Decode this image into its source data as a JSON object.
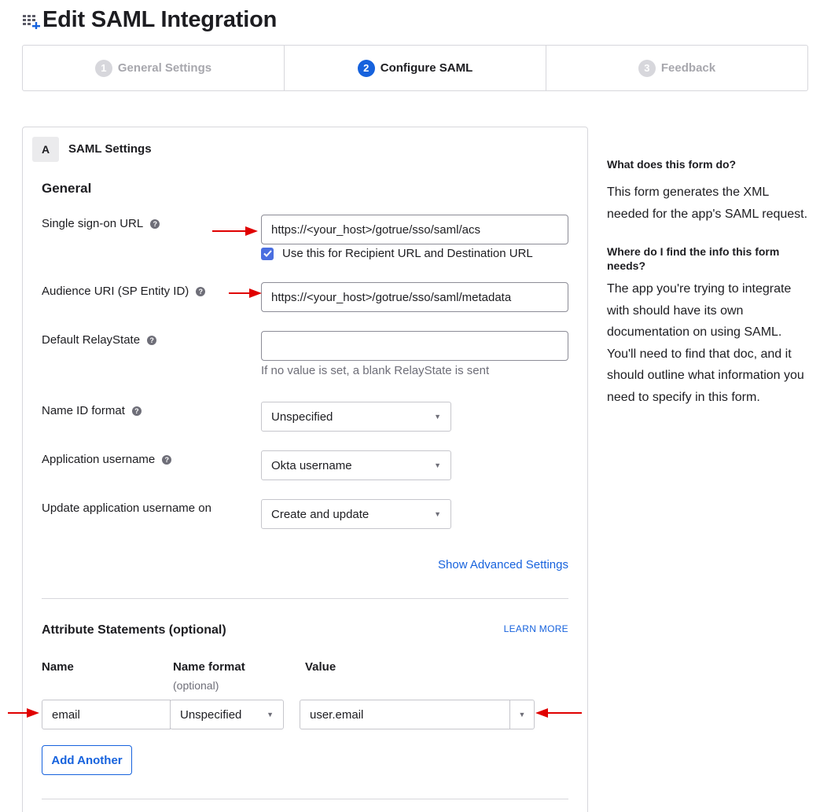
{
  "header": {
    "title": "Edit SAML Integration",
    "icon": "app-grid-plus-icon"
  },
  "steps": [
    {
      "num": "1",
      "label": "General Settings",
      "state": "inactive"
    },
    {
      "num": "2",
      "label": "Configure SAML",
      "state": "active"
    },
    {
      "num": "3",
      "label": "Feedback",
      "state": "inactive"
    }
  ],
  "saml_settings": {
    "badge": "A",
    "title": "SAML Settings",
    "general_heading": "General",
    "sso_url": {
      "label": "Single sign-on URL",
      "value": "https://<your_host>/gotrue/sso/saml/acs",
      "checkbox_label": "Use this for Recipient URL and Destination URL",
      "checkbox_checked": true
    },
    "audience_uri": {
      "label": "Audience URI (SP Entity ID)",
      "value": "https://<your_host>/gotrue/sso/saml/metadata"
    },
    "relay_state": {
      "label": "Default RelayState",
      "value": "",
      "hint": "If no value is set, a blank RelayState is sent"
    },
    "name_id_format": {
      "label": "Name ID format",
      "value": "Unspecified"
    },
    "app_username": {
      "label": "Application username",
      "value": "Okta username"
    },
    "update_username_on": {
      "label": "Update application username on",
      "value": "Create and update"
    },
    "advanced_link": "Show Advanced Settings"
  },
  "attributes": {
    "heading": "Attribute Statements (optional)",
    "learn_more": "LEARN MORE",
    "col_name": "Name",
    "col_format": "Name format",
    "col_format_sub": "(optional)",
    "col_value": "Value",
    "row": {
      "name": "email",
      "format": "Unspecified",
      "value": "user.email"
    },
    "add_button": "Add Another"
  },
  "sidebar": {
    "q1": "What does this form do?",
    "a1": "This form generates the XML needed for the app's SAML request.",
    "q2": "Where do I find the info this form needs?",
    "a2": "The app you're trying to integrate with should have its own documentation on using SAML. You'll need to find that doc, and it should outline what information you need to specify in this form."
  },
  "colors": {
    "accent": "#1662dd",
    "annotation_arrow": "#e00000"
  }
}
